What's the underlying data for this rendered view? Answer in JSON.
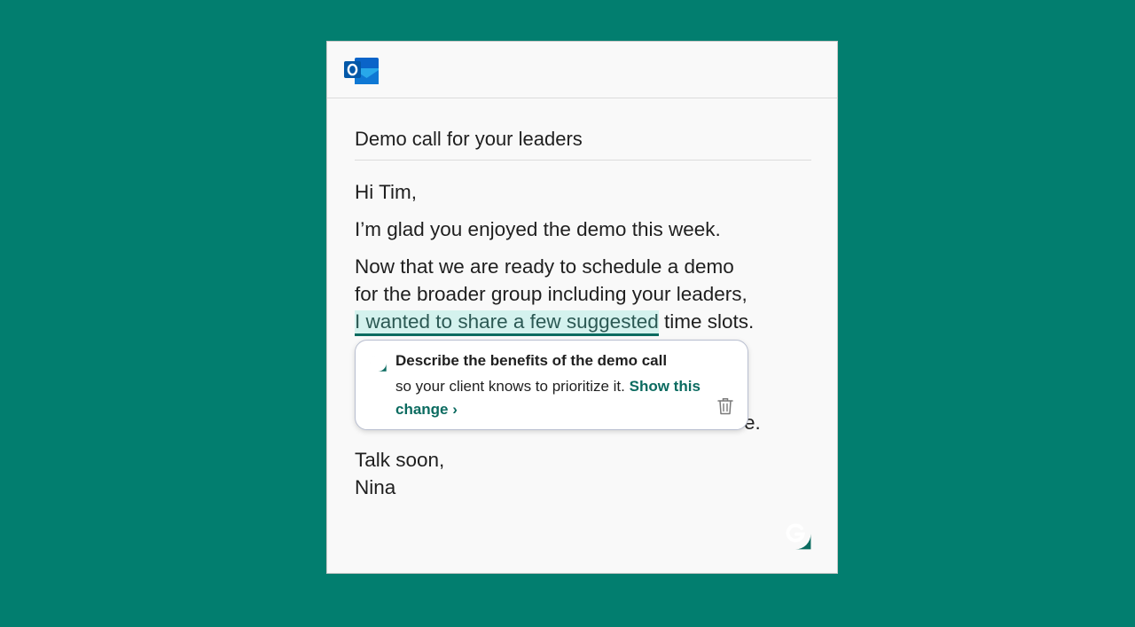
{
  "email": {
    "subject": "Demo call for your leaders",
    "greeting": "Hi Tim,",
    "line_glad": "I’m glad you enjoyed the demo this week.",
    "para_line1": "Now that we are ready to schedule a demo",
    "para_line2": "for the broader group including your leaders,",
    "para_highlight": "I wanted to share a few suggested",
    "para_tail": " time slots.",
    "partial_line_tail": "e.",
    "signoff": "Talk soon,",
    "signature": "Nina"
  },
  "suggestion": {
    "title": "Describe the benefits of the demo call",
    "description": "so your client knows to prioritize it.",
    "link": "Show this change ›"
  },
  "icons": {
    "app_icon": "outlook-icon",
    "suggestion_icon": "grammarly-icon",
    "dismiss_icon": "trash-icon",
    "assistant_icon": "grammarly-icon"
  },
  "colors": {
    "background": "#027e6f",
    "accent": "#0b6b60",
    "highlight": "#d4f2ee",
    "outlook_blue": "#0a64c9"
  }
}
